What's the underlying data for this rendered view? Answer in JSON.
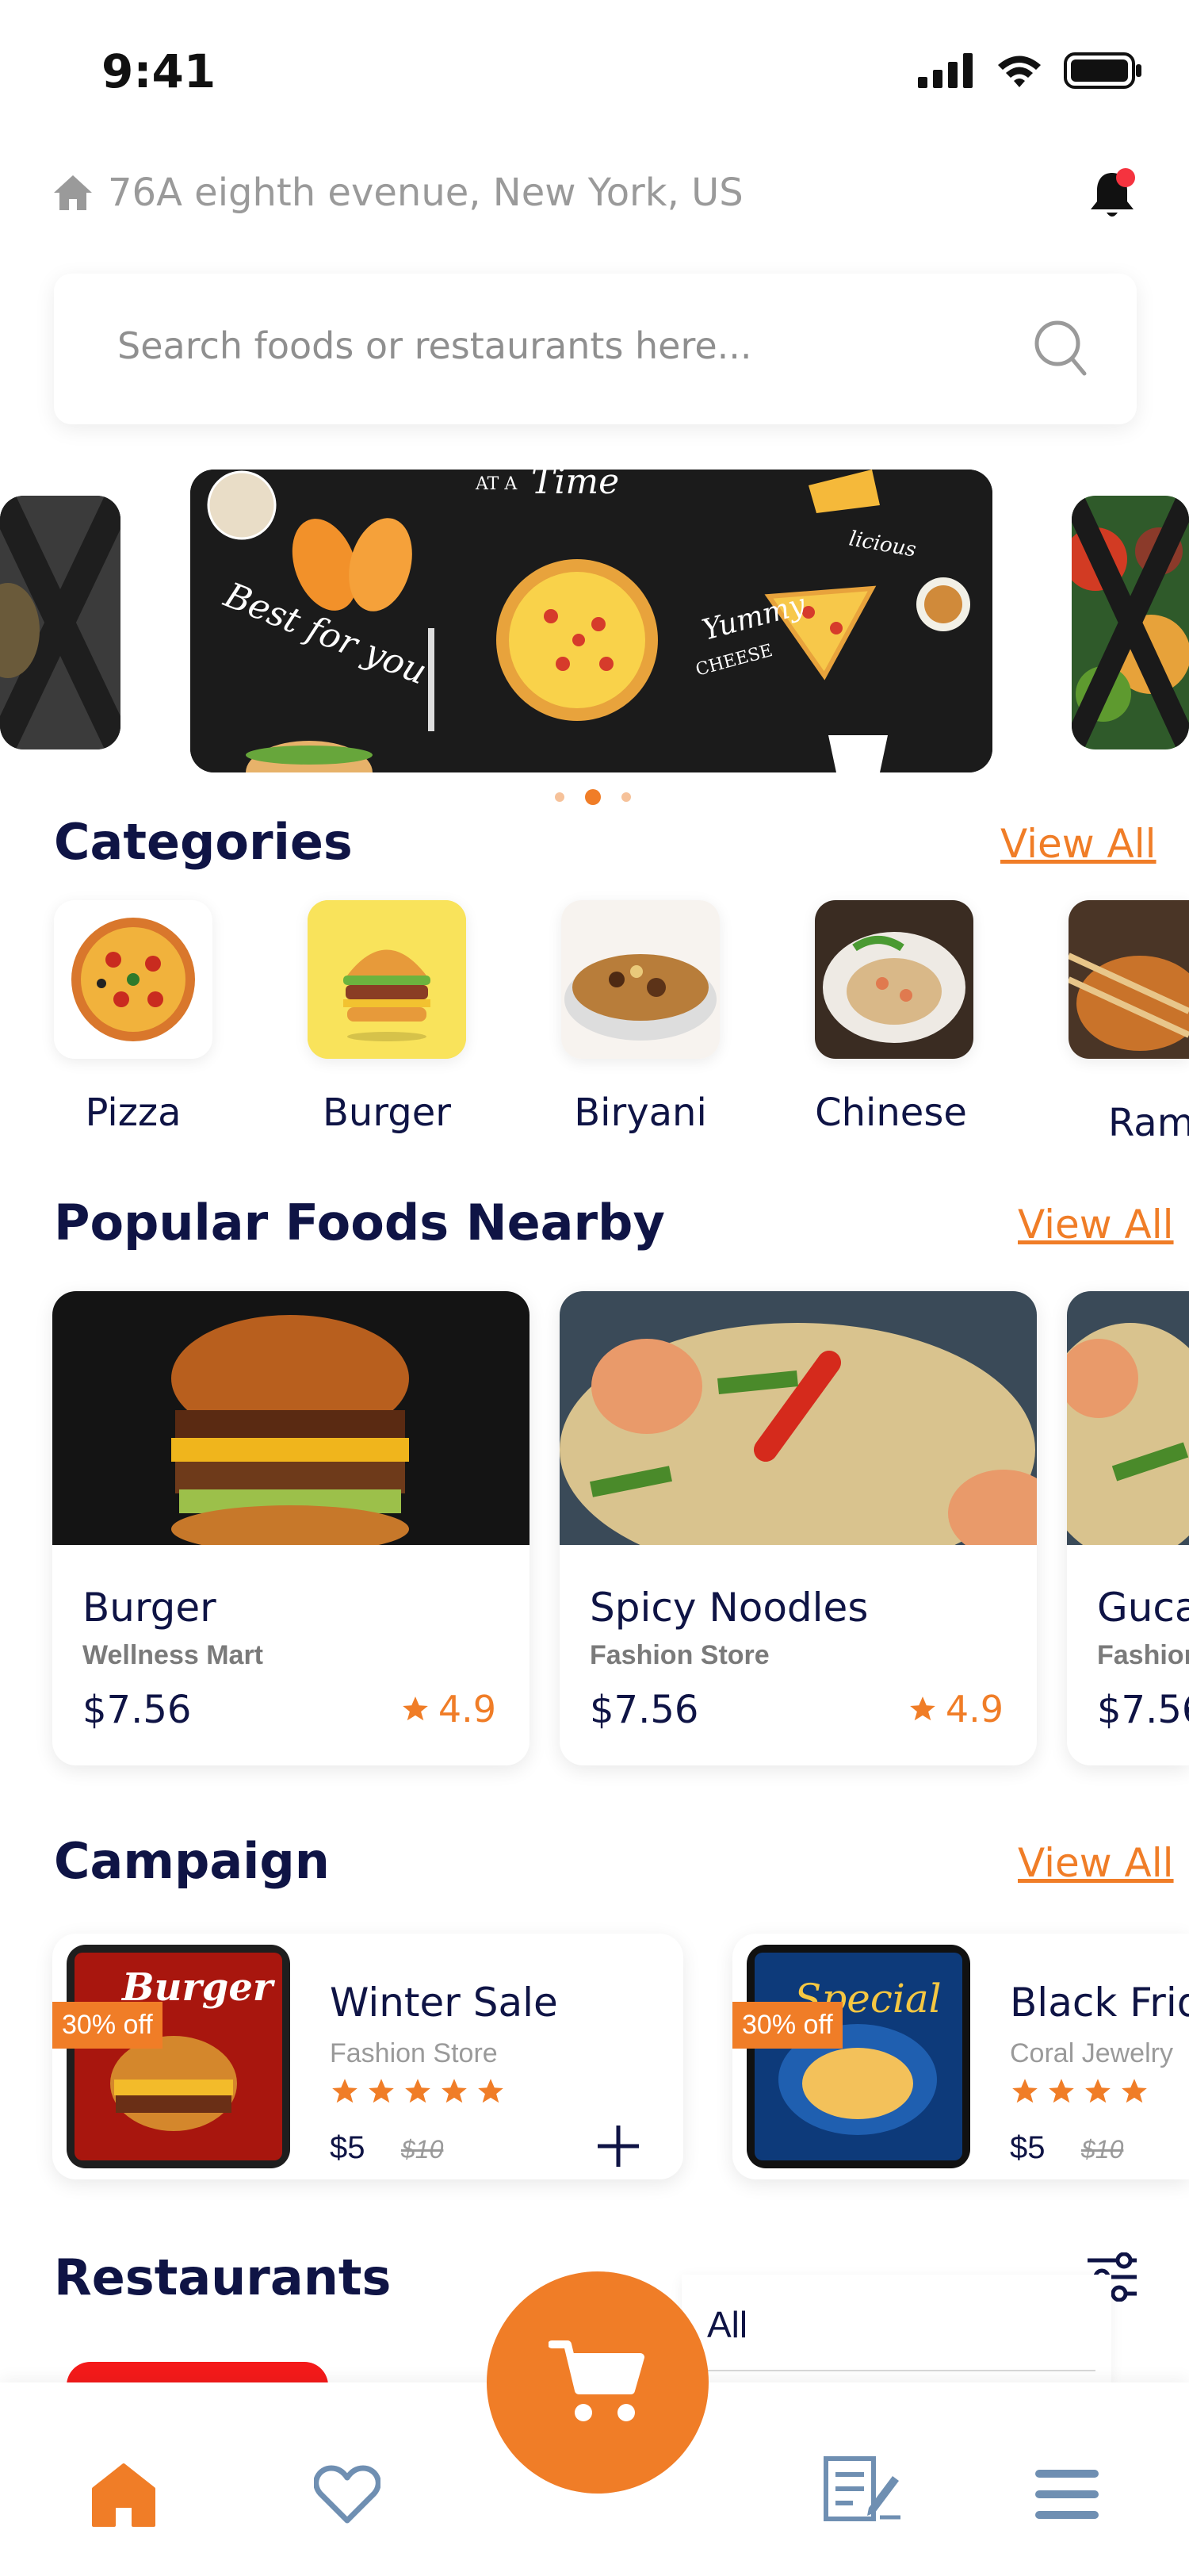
{
  "status_bar": {
    "time": "9:41"
  },
  "header": {
    "address": "76A eighth evenue, New York, US"
  },
  "search": {
    "placeholder": "Search foods or restaurants  here..."
  },
  "banner": {
    "texts": [
      "AT A",
      "Time",
      "Best for you",
      "Yummy",
      "CHEESE",
      "licious"
    ]
  },
  "categories": {
    "title": "Categories",
    "view_all": "View All",
    "items": [
      {
        "label": "Pizza"
      },
      {
        "label": "Burger"
      },
      {
        "label": "Biryani"
      },
      {
        "label": "Chinese"
      },
      {
        "label": "Ram"
      }
    ]
  },
  "popular": {
    "title": "Popular Foods Nearby",
    "view_all": "View All",
    "items": [
      {
        "name": "Burger",
        "store": "Wellness Mart",
        "price": "$7.56",
        "rating": "4.9"
      },
      {
        "name": "Spicy Noodles",
        "store": "Fashion Store",
        "price": "$7.56",
        "rating": "4.9"
      },
      {
        "name": "Guca",
        "store": "Fashion",
        "price": "$7.56",
        "rating": ""
      }
    ]
  },
  "campaign": {
    "title": "Campaign",
    "view_all": "View All",
    "items": [
      {
        "title": "Winter Sale",
        "store": "Fashion Store",
        "price": "$5",
        "old_price": "$10",
        "badge": "30% off",
        "poster_text": "Burger"
      },
      {
        "title": "Black Frid",
        "store": "Coral Jewelry",
        "price": "$5",
        "old_price": "$10",
        "badge": "30% off",
        "poster_text": "Special"
      }
    ]
  },
  "restaurants": {
    "title": "Restaurants",
    "filter_option": "All"
  },
  "colors": {
    "accent": "#f07d27",
    "navy": "#0f1445",
    "nav_icon": "#6f8fb2"
  },
  "nav": {
    "items": [
      "home-icon",
      "heart-icon",
      "cart-icon",
      "orders-icon",
      "menu-icon"
    ]
  }
}
